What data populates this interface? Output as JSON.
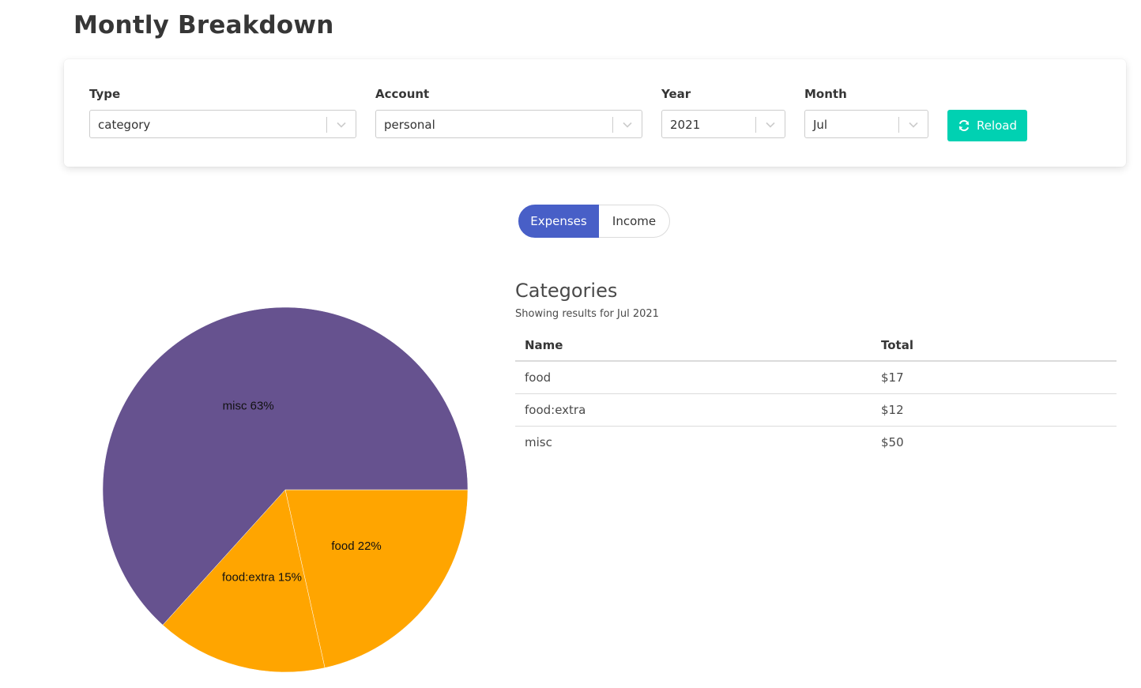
{
  "page": {
    "title": "Montly Breakdown"
  },
  "filters": {
    "type": {
      "label": "Type",
      "value": "category"
    },
    "account": {
      "label": "Account",
      "value": "personal"
    },
    "year": {
      "label": "Year",
      "value": "2021"
    },
    "month": {
      "label": "Month",
      "value": "Jul"
    },
    "reload_label": "Reload"
  },
  "toggle": {
    "expenses": "Expenses",
    "income": "Income",
    "active": "Expenses"
  },
  "colors": {
    "accent": "#485fc7",
    "reload": "#00d1b2",
    "misc": "#66528f",
    "food": "#ffa500"
  },
  "categories": {
    "title": "Categories",
    "subtitle": "Showing results for Jul 2021",
    "columns": [
      "Name",
      "Total"
    ],
    "rows": [
      {
        "name": "food",
        "total": "$17"
      },
      {
        "name": "food:extra",
        "total": "$12"
      },
      {
        "name": "misc",
        "total": "$50"
      }
    ]
  },
  "chart_data": {
    "type": "pie",
    "slices": [
      {
        "label": "food",
        "value": 17,
        "percent_label": "food 22%",
        "color": "#ffa500"
      },
      {
        "label": "food:extra",
        "value": 12,
        "percent_label": "food:extra 15%",
        "color": "#ffa500"
      },
      {
        "label": "misc",
        "value": 50,
        "percent_label": "misc 63%",
        "color": "#66528f"
      }
    ]
  }
}
